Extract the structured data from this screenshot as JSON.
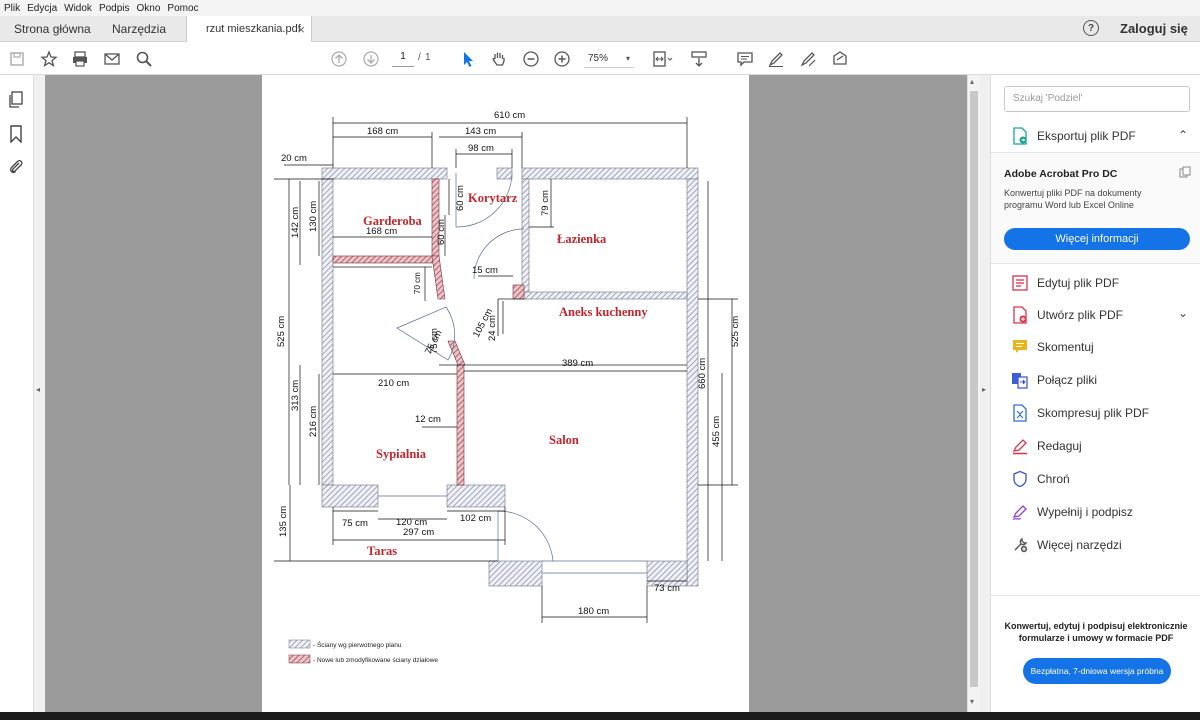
{
  "menu": [
    "Plik",
    "Edycja",
    "Widok",
    "Podpis",
    "Okno",
    "Pomoc"
  ],
  "tabs": {
    "home": "Strona główna",
    "tools": "Narzędzia",
    "doc": "rzut mieszkania.pdf",
    "doc_close": "×"
  },
  "header": {
    "help_icon": "?",
    "login": "Zaloguj się"
  },
  "toolbar": {
    "page_current": "1",
    "page_sep": "/",
    "page_total": "1",
    "zoom": "75%"
  },
  "search": {
    "placeholder": "Szukaj 'Podziel'"
  },
  "export": {
    "label": "Eksportuj plik PDF"
  },
  "promo": {
    "title": "Adobe Acrobat Pro DC",
    "body": "Konwertuj pliki PDF na dokumenty programu Word lub Excel Online",
    "button": "Więcej informacji"
  },
  "tools": [
    {
      "label": "Edytuj plik PDF",
      "color": "#d9344e"
    },
    {
      "label": "Utwórz plik PDF",
      "color": "#d9344e"
    },
    {
      "label": "Skomentuj",
      "color": "#e8b51a"
    },
    {
      "label": "Połącz pliki",
      "color": "#3f5bd8"
    },
    {
      "label": "Skompresuj plik PDF",
      "color": "#2f6fd1"
    },
    {
      "label": "Redaguj",
      "color": "#d9344e"
    },
    {
      "label": "Chroń",
      "color": "#3f5bd8"
    },
    {
      "label": "Wypełnij i podpisz",
      "color": "#8e3fd8"
    },
    {
      "label": "Więcej narzędzi",
      "color": "#555555"
    }
  ],
  "footer_promo": {
    "text": "Konwertuj, edytuj i podpisuj elektronicznie formularze i umowy w formacie PDF",
    "button": "Bezpłatna, 7-dniowa wersja próbna"
  },
  "plan": {
    "rooms": {
      "korytarz": "Korytarz",
      "garderoba": "Garderoba",
      "lazienka": "Łazienka",
      "aneks": "Aneks kuchenny",
      "sypialnia": "Sypialnia",
      "salon": "Salon",
      "taras": "Taras"
    },
    "dims": {
      "d610": "610 cm",
      "d168": "168 cm",
      "d143": "143 cm",
      "d98": "98 cm",
      "d20": "20 cm",
      "d60a": "60 cm",
      "d79": "79 cm",
      "d142": "142 cm",
      "d130": "130 cm",
      "d168b": "168 cm",
      "d60b": "60 cm",
      "d70": "70 cm",
      "d15": "15 cm",
      "d105": "105 cm",
      "d24": "24 cm",
      "d75a": "75 cm",
      "d75b": "75 cm",
      "d525a": "525 cm",
      "d525b": "525 cm",
      "d389": "389 cm",
      "d210": "210 cm",
      "d313": "313 cm",
      "d216": "216 cm",
      "d12": "12 cm",
      "d660": "660 cm",
      "d455": "455 cm",
      "d135": "135 cm",
      "d75c": "75 cm",
      "d120": "120 cm",
      "d102": "102 cm",
      "d297": "297 cm",
      "d73": "73 cm",
      "d180": "180 cm"
    },
    "legend": {
      "original": "- Ściany wg pierwotnego planu",
      "modified": "- Nowe lub zmodyfikowane ściany działowe"
    }
  },
  "colors": {
    "accent": "#1473e6",
    "new_wall": "#b4505a",
    "orig_wall": "#8a94a8",
    "room_label": "#c0282d"
  }
}
